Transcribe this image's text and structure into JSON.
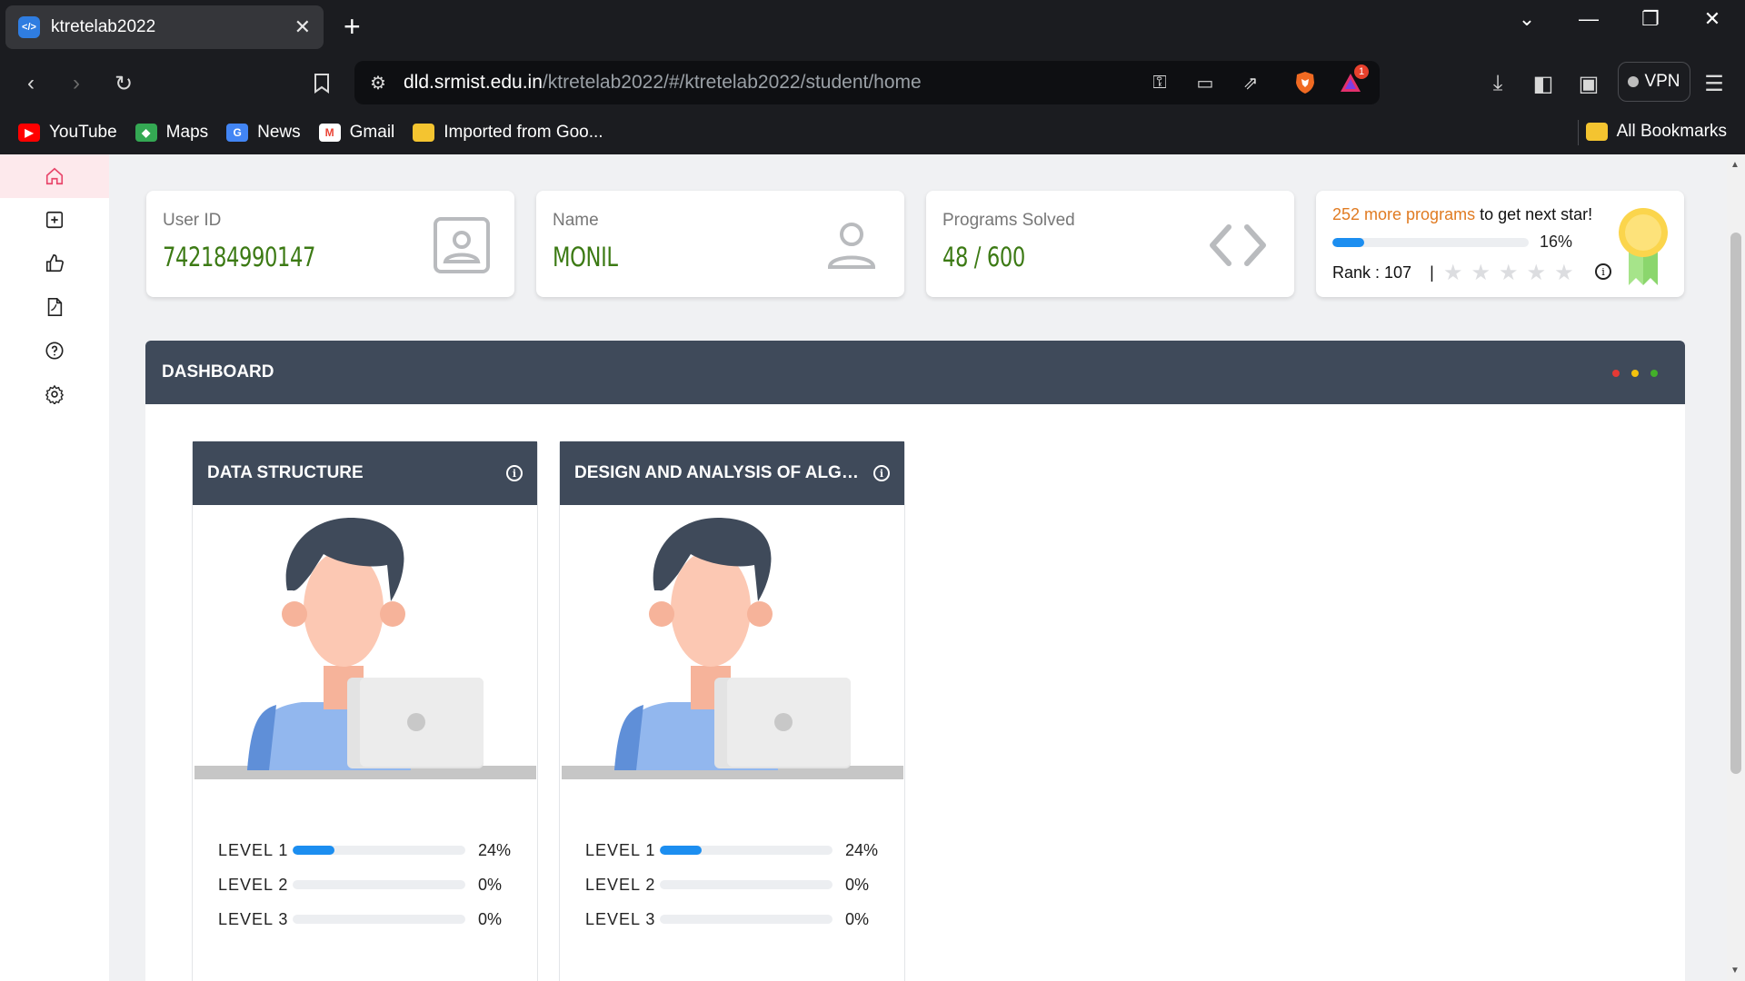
{
  "browser": {
    "tab_title": "ktretelab2022",
    "url_host": "dld.srmist.edu.in",
    "url_path": "/ktretelab2022/#/ktretelab2022/student/home",
    "vpn_label": "VPN",
    "notification_count": "1",
    "bookmarks": [
      {
        "label": "YouTube",
        "icon": "youtube-icon",
        "color": "#ff0000"
      },
      {
        "label": "Maps",
        "icon": "maps-icon",
        "color": "#34a853"
      },
      {
        "label": "News",
        "icon": "news-icon",
        "color": "#4285f4"
      },
      {
        "label": "Gmail",
        "icon": "gmail-icon",
        "color": "#ea4335"
      },
      {
        "label": "Imported from Goo...",
        "icon": "folder-icon",
        "color": "#f4c430"
      }
    ],
    "all_bookmarks_label": "All Bookmarks"
  },
  "sidebar": {
    "items": [
      {
        "icon": "home-icon",
        "active": true
      },
      {
        "icon": "add-square-icon",
        "active": false
      },
      {
        "icon": "thumbs-up-icon",
        "active": false
      },
      {
        "icon": "pdf-file-icon",
        "active": false
      },
      {
        "icon": "help-circle-icon",
        "active": false
      },
      {
        "icon": "gear-icon",
        "active": false
      }
    ],
    "active_color": "#e8456a"
  },
  "stats": {
    "user_id_label": "User ID",
    "user_id_value": "742184990147",
    "name_label": "Name",
    "name_value": "MONIL",
    "programs_label": "Programs Solved",
    "programs_value": "48 / 600",
    "value_color": "#3c7a14"
  },
  "star_card": {
    "remaining": "252 more programs",
    "message_rest": " to get next star!",
    "progress_percent": 16,
    "progress_label": "16%",
    "rank_label": "Rank : 107",
    "stars_filled": 0,
    "stars_total": 5
  },
  "dashboard": {
    "title": "DASHBOARD",
    "courses": [
      {
        "title": "DATA STRUCTURE",
        "levels": [
          {
            "name": "LEVEL 1",
            "percent": 24,
            "label": "24%"
          },
          {
            "name": "LEVEL 2",
            "percent": 0,
            "label": "0%"
          },
          {
            "name": "LEVEL 3",
            "percent": 0,
            "label": "0%"
          }
        ]
      },
      {
        "title": "DESIGN AND ANALYSIS OF ALGO...",
        "levels": [
          {
            "name": "LEVEL 1",
            "percent": 24,
            "label": "24%"
          },
          {
            "name": "LEVEL 2",
            "percent": 0,
            "label": "0%"
          },
          {
            "name": "LEVEL 3",
            "percent": 0,
            "label": "0%"
          }
        ]
      }
    ]
  }
}
